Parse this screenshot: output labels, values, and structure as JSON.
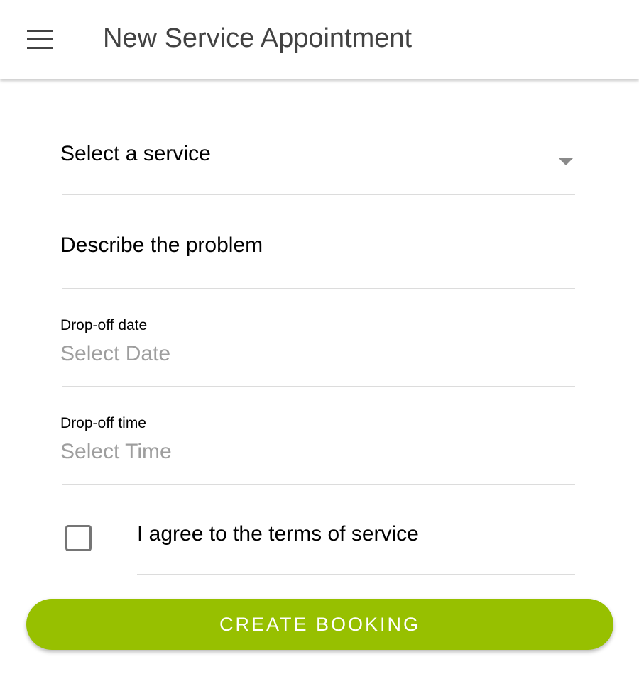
{
  "header": {
    "title": "New Service Appointment",
    "menu_icon": "hamburger-menu-icon"
  },
  "form": {
    "service": {
      "label": "Select a service",
      "icon": "dropdown-caret-icon"
    },
    "problem": {
      "label": "Describe the problem"
    },
    "date": {
      "label": "Drop-off date",
      "placeholder": "Select Date"
    },
    "time": {
      "label": "Drop-off time",
      "placeholder": "Select Time"
    },
    "terms": {
      "label": "I agree to the terms of service",
      "checked": false
    },
    "submit_label": "CREATE BOOKING"
  },
  "colors": {
    "accent": "#97c000",
    "header_text": "#424242",
    "placeholder": "#9e9e9e",
    "divider": "#dcdcdc"
  }
}
